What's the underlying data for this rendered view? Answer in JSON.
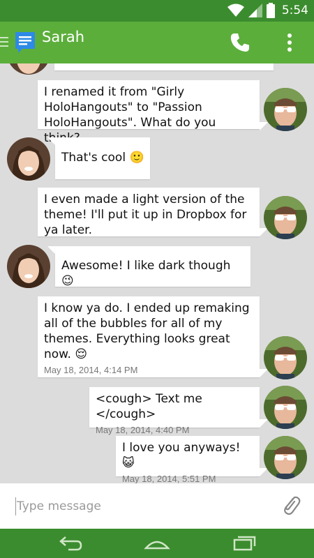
{
  "status_bar": {
    "time": "5:54"
  },
  "header": {
    "contact_name": "Sarah"
  },
  "conversation": {
    "messages": [
      {
        "from": "me",
        "text": "I renamed it from \"Girly HoloHangouts\" to \"Passion HoloHangouts\". What do you think?",
        "timestamp": ""
      },
      {
        "from": "sarah",
        "text": "That's cool 🙂",
        "timestamp": ""
      },
      {
        "from": "me",
        "text": "I even made a light version of the theme! I'll put it up in Dropbox for ya later.",
        "timestamp": ""
      },
      {
        "from": "sarah",
        "text": "Awesome! I like dark though 😉",
        "timestamp": ""
      },
      {
        "from": "me",
        "text": "I know ya do. I ended up remaking all of the bubbles for all of my themes. Everything looks great now. 😌",
        "timestamp": "May 18, 2014, 4:14 PM"
      },
      {
        "from": "me",
        "text": "<cough> Text me </cough>",
        "timestamp": "May 18, 2014, 4:40 PM"
      },
      {
        "from": "me",
        "text": "I love you anyways! 😺",
        "timestamp": "May 18, 2014, 5:51 PM"
      }
    ]
  },
  "compose": {
    "placeholder": "Type message"
  },
  "colors": {
    "status_bar": "#3b8c2e",
    "action_bar": "#5cae3b",
    "background": "#dcdcdc",
    "bubble": "#ffffff"
  }
}
